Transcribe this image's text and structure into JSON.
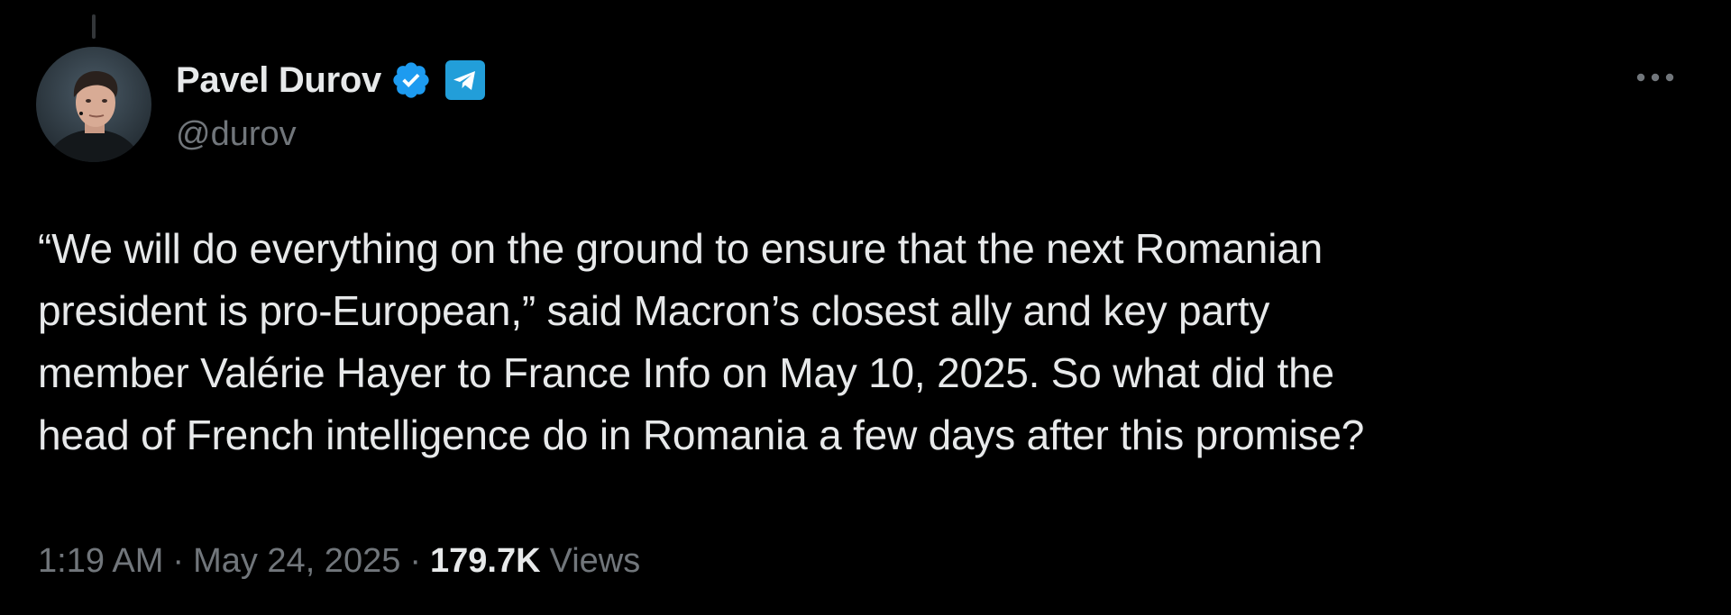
{
  "author": {
    "display_name": "Pavel Durov",
    "handle": "@durov",
    "verified_icon": "verified-badge-icon",
    "affiliate_icon": "telegram-icon",
    "avatar_icon": "profile-photo"
  },
  "tweet": {
    "text": "“We will do everything on the ground to ensure that the next Romanian\npresident is pro-European,” said Macron’s closest ally and key party\nmember Valérie Hayer to France Info on May 10, 2025. So what did the\nhead of French intelligence do in Romania a few days after this promise?"
  },
  "meta": {
    "time": "1:19 AM",
    "separator": "·",
    "date": "May 24, 2025",
    "views_count": "179.7K",
    "views_label": "Views"
  },
  "actions": {
    "more_icon": "more-options-icon"
  },
  "colors": {
    "background": "#000000",
    "primary_text": "#e7e9ea",
    "secondary_text": "#71767b",
    "verified_blue": "#1d9bf0",
    "telegram_blue": "#229ed9"
  }
}
